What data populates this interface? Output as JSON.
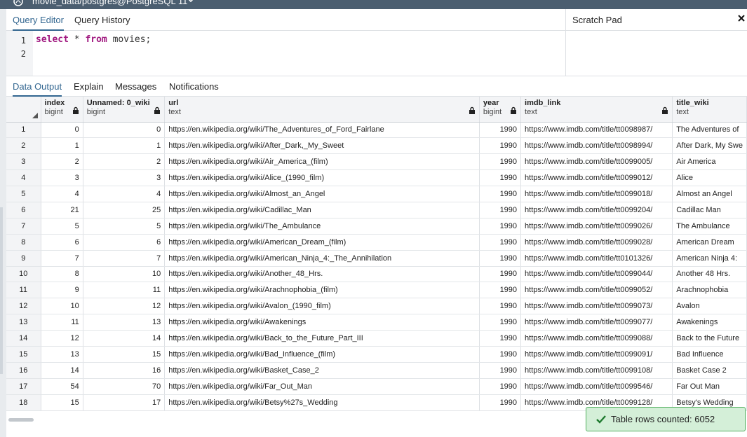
{
  "window": {
    "title": "movie_data/postgres@PostgreSQL 11"
  },
  "editor": {
    "tabs": [
      {
        "label": "Query Editor"
      },
      {
        "label": "Query History"
      }
    ],
    "line_numbers": [
      "1",
      "2"
    ],
    "code": {
      "kw1": "select",
      "rest1": " * ",
      "kw2": "from",
      "rest2": " movies;"
    }
  },
  "scratch": {
    "label": "Scratch Pad"
  },
  "output": {
    "tabs": [
      {
        "label": "Data Output"
      },
      {
        "label": "Explain"
      },
      {
        "label": "Messages"
      },
      {
        "label": "Notifications"
      }
    ],
    "columns": [
      {
        "name": "index",
        "type": "bigint"
      },
      {
        "name": "Unnamed: 0_wiki",
        "type": "bigint"
      },
      {
        "name": "url",
        "type": "text"
      },
      {
        "name": "year",
        "type": "bigint"
      },
      {
        "name": "imdb_link",
        "type": "text"
      },
      {
        "name": "title_wiki",
        "type": "text"
      }
    ],
    "rows": [
      {
        "n": "1",
        "index": "0",
        "unnamed": "0",
        "url": "https://en.wikipedia.org/wiki/The_Adventures_of_Ford_Fairlane",
        "year": "1990",
        "imdb": "https://www.imdb.com/title/tt0098987/",
        "title": "The Adventures of"
      },
      {
        "n": "2",
        "index": "1",
        "unnamed": "1",
        "url": "https://en.wikipedia.org/wiki/After_Dark,_My_Sweet",
        "year": "1990",
        "imdb": "https://www.imdb.com/title/tt0098994/",
        "title": "After Dark, My Swe"
      },
      {
        "n": "3",
        "index": "2",
        "unnamed": "2",
        "url": "https://en.wikipedia.org/wiki/Air_America_(film)",
        "year": "1990",
        "imdb": "https://www.imdb.com/title/tt0099005/",
        "title": "Air America"
      },
      {
        "n": "4",
        "index": "3",
        "unnamed": "3",
        "url": "https://en.wikipedia.org/wiki/Alice_(1990_film)",
        "year": "1990",
        "imdb": "https://www.imdb.com/title/tt0099012/",
        "title": "Alice"
      },
      {
        "n": "5",
        "index": "4",
        "unnamed": "4",
        "url": "https://en.wikipedia.org/wiki/Almost_an_Angel",
        "year": "1990",
        "imdb": "https://www.imdb.com/title/tt0099018/",
        "title": "Almost an Angel"
      },
      {
        "n": "6",
        "index": "21",
        "unnamed": "25",
        "url": "https://en.wikipedia.org/wiki/Cadillac_Man",
        "year": "1990",
        "imdb": "https://www.imdb.com/title/tt0099204/",
        "title": "Cadillac Man"
      },
      {
        "n": "7",
        "index": "5",
        "unnamed": "5",
        "url": "https://en.wikipedia.org/wiki/The_Ambulance",
        "year": "1990",
        "imdb": "https://www.imdb.com/title/tt0099026/",
        "title": "The Ambulance"
      },
      {
        "n": "8",
        "index": "6",
        "unnamed": "6",
        "url": "https://en.wikipedia.org/wiki/American_Dream_(film)",
        "year": "1990",
        "imdb": "https://www.imdb.com/title/tt0099028/",
        "title": "American Dream"
      },
      {
        "n": "9",
        "index": "7",
        "unnamed": "7",
        "url": "https://en.wikipedia.org/wiki/American_Ninja_4:_The_Annihilation",
        "year": "1990",
        "imdb": "https://www.imdb.com/title/tt0101326/",
        "title": "American Ninja 4:"
      },
      {
        "n": "10",
        "index": "8",
        "unnamed": "10",
        "url": "https://en.wikipedia.org/wiki/Another_48_Hrs.",
        "year": "1990",
        "imdb": "https://www.imdb.com/title/tt0099044/",
        "title": "Another 48 Hrs."
      },
      {
        "n": "11",
        "index": "9",
        "unnamed": "11",
        "url": "https://en.wikipedia.org/wiki/Arachnophobia_(film)",
        "year": "1990",
        "imdb": "https://www.imdb.com/title/tt0099052/",
        "title": "Arachnophobia"
      },
      {
        "n": "12",
        "index": "10",
        "unnamed": "12",
        "url": "https://en.wikipedia.org/wiki/Avalon_(1990_film)",
        "year": "1990",
        "imdb": "https://www.imdb.com/title/tt0099073/",
        "title": "Avalon"
      },
      {
        "n": "13",
        "index": "11",
        "unnamed": "13",
        "url": "https://en.wikipedia.org/wiki/Awakenings",
        "year": "1990",
        "imdb": "https://www.imdb.com/title/tt0099077/",
        "title": "Awakenings"
      },
      {
        "n": "14",
        "index": "12",
        "unnamed": "14",
        "url": "https://en.wikipedia.org/wiki/Back_to_the_Future_Part_III",
        "year": "1990",
        "imdb": "https://www.imdb.com/title/tt0099088/",
        "title": "Back to the Future"
      },
      {
        "n": "15",
        "index": "13",
        "unnamed": "15",
        "url": "https://en.wikipedia.org/wiki/Bad_Influence_(film)",
        "year": "1990",
        "imdb": "https://www.imdb.com/title/tt0099091/",
        "title": "Bad Influence"
      },
      {
        "n": "16",
        "index": "14",
        "unnamed": "16",
        "url": "https://en.wikipedia.org/wiki/Basket_Case_2",
        "year": "1990",
        "imdb": "https://www.imdb.com/title/tt0099108/",
        "title": "Basket Case 2"
      },
      {
        "n": "17",
        "index": "54",
        "unnamed": "70",
        "url": "https://en.wikipedia.org/wiki/Far_Out_Man",
        "year": "1990",
        "imdb": "https://www.imdb.com/title/tt0099546/",
        "title": "Far Out Man"
      },
      {
        "n": "18",
        "index": "15",
        "unnamed": "17",
        "url": "https://en.wikipedia.org/wiki/Betsy%27s_Wedding",
        "year": "1990",
        "imdb": "https://www.imdb.com/title/tt0099128/",
        "title": "Betsy's Wedding"
      }
    ]
  },
  "toast": {
    "message": "Table rows counted: 6052"
  },
  "icons": {
    "logo": "elephant-logo-icon",
    "dropdown": "chevron-down-icon",
    "close": "close-icon",
    "lock": "lock-icon",
    "sort": "sort-corner-icon",
    "check": "check-icon"
  },
  "colors": {
    "accent": "#326690",
    "keyword": "#a0177f",
    "titlebar": "#4b5e70",
    "success_bg": "#d4efd8",
    "success_border": "#53b060"
  }
}
